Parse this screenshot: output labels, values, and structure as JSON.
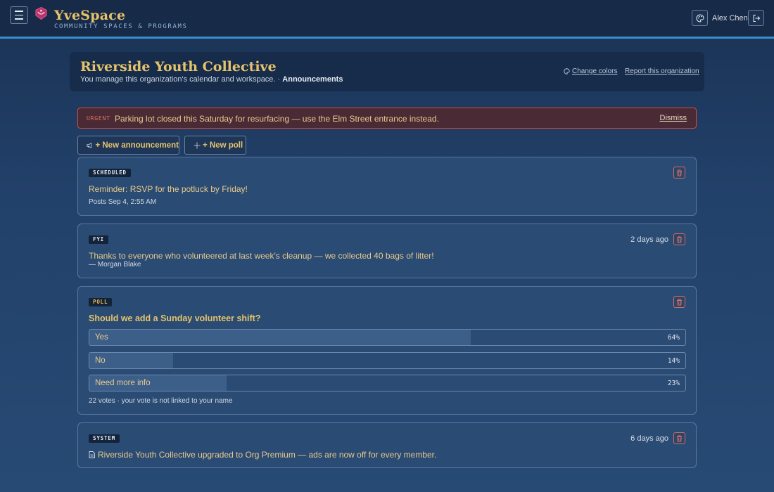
{
  "app": {
    "brand": "YveSpace",
    "tagline": "COMMUNITY SPACES & PROGRAMS",
    "user_name": "Alex Chen"
  },
  "org": {
    "title": "Riverside Youth Collective",
    "subtitle": "You manage this organization's calendar and workspace.",
    "separator": "·",
    "section": "Announcements",
    "change_colors": "Change colors",
    "report": "Report this organization"
  },
  "urgent": {
    "tag": "URGENT",
    "text": "Parking lot closed this Saturday for resurfacing — use the Elm Street entrance instead.",
    "dismiss": "Dismiss"
  },
  "actions": {
    "new_announcement": "+ New announcement",
    "new_poll": "+ New poll"
  },
  "posts": [
    {
      "tag": "SCHEDULED",
      "text": "Reminder: RSVP for the potluck by Friday!",
      "meta": "Posts Sep 4, 2:55 AM"
    },
    {
      "tag": "FYI",
      "time": "2 days ago",
      "text": "Thanks to everyone who volunteered at last week's cleanup — we collected 40 bags of litter!",
      "meta": "— Morgan Blake"
    },
    {
      "tag": "POLL",
      "question": "Should we add a Sunday volunteer shift?",
      "options": [
        {
          "label": "Yes",
          "percent_text": "64%",
          "percent": 64
        },
        {
          "label": "No",
          "percent_text": "14%",
          "percent": 14
        },
        {
          "label": "Need more info",
          "percent_text": "23%",
          "percent": 23
        }
      ],
      "meta": "22 votes · your vote is not linked to your name"
    },
    {
      "tag": "SYSTEM",
      "time": "6 days ago",
      "text": "Riverside Youth Collective upgraded to Org Premium — ads are now off for every member."
    }
  ],
  "colors": {
    "accent_gold": "#e6c36b",
    "urgent_red": "#d24a3e",
    "topbar_border": "#3d8ed0"
  }
}
